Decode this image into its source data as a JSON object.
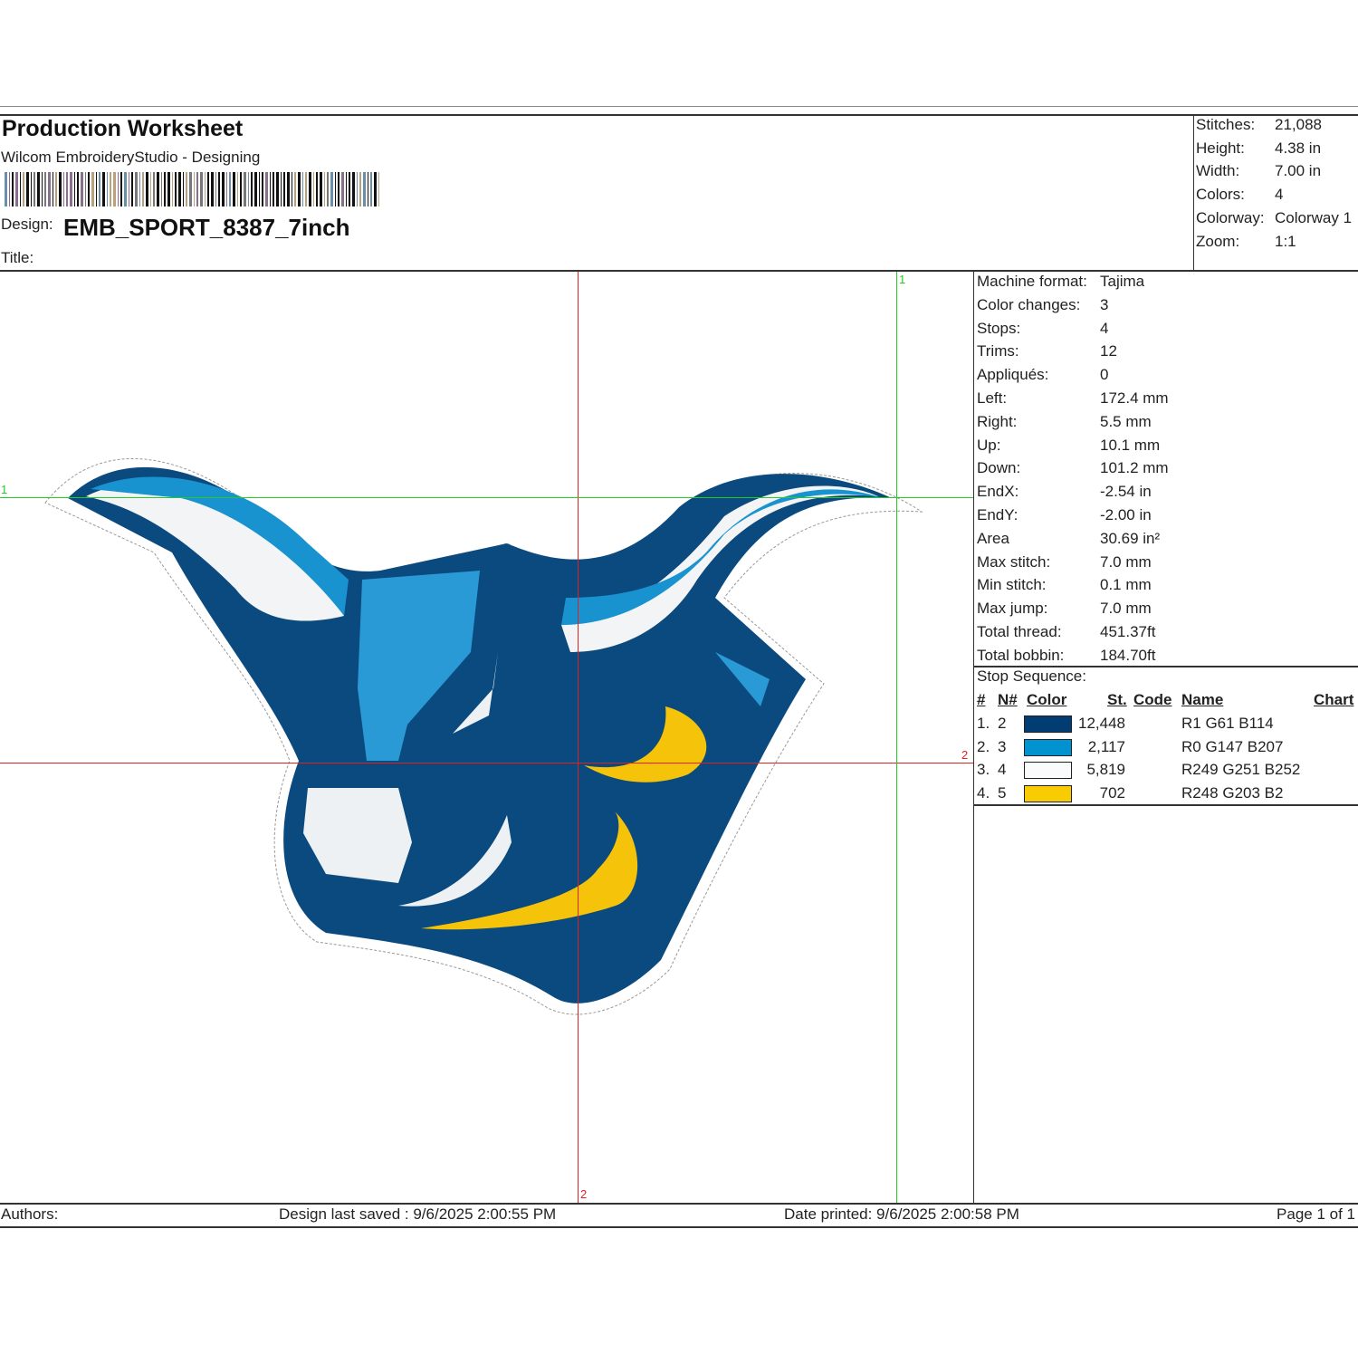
{
  "header": {
    "title": "Production Worksheet",
    "subtitle": "Wilcom EmbroideryStudio - Designing",
    "design_label": "Design:",
    "design_name": "EMB_SPORT_8387_7inch",
    "title_label": "Title:",
    "title_value": ""
  },
  "summary": [
    {
      "label": "Stitches:",
      "value": "21,088"
    },
    {
      "label": "Height:",
      "value": "4.38 in"
    },
    {
      "label": "Width:",
      "value": "7.00 in"
    },
    {
      "label": "Colors:",
      "value": "4"
    },
    {
      "label": "Colorway:",
      "value": "Colorway 1"
    },
    {
      "label": "Zoom:",
      "value": "1:1"
    }
  ],
  "details": [
    {
      "label": "Machine format:",
      "value": "Tajima"
    },
    {
      "label": "Color changes:",
      "value": "3"
    },
    {
      "label": "Stops:",
      "value": "4"
    },
    {
      "label": "Trims:",
      "value": "12"
    },
    {
      "label": "Appliqués:",
      "value": "0"
    },
    {
      "label": "Left:",
      "value": "172.4 mm"
    },
    {
      "label": "Right:",
      "value": "5.5 mm"
    },
    {
      "label": "Up:",
      "value": "10.1 mm"
    },
    {
      "label": "Down:",
      "value": "101.2 mm"
    },
    {
      "label": "EndX:",
      "value": "-2.54 in"
    },
    {
      "label": "EndY:",
      "value": "-2.00 in"
    },
    {
      "label": "Area",
      "value": " 30.69 in²"
    },
    {
      "label": "Max stitch:",
      "value": "7.0 mm"
    },
    {
      "label": "Min stitch:",
      "value": "0.1 mm"
    },
    {
      "label": "Max jump:",
      "value": "7.0 mm"
    },
    {
      "label": "Total thread:",
      "value": "451.37ft"
    },
    {
      "label": "Total bobbin:",
      "value": "184.70ft"
    }
  ],
  "stop_sequence": {
    "title": "Stop Sequence:",
    "columns": {
      "num": "#",
      "needle": "N#",
      "color": "Color",
      "stitches": "St.",
      "code": "Code",
      "name": "Name",
      "chart": "Chart"
    },
    "rows": [
      {
        "num": "1.",
        "needle": "2",
        "color": "#013d72",
        "stitches": "12,448",
        "name": "R1 G61 B114"
      },
      {
        "num": "2.",
        "needle": "3",
        "color": "#0093cf",
        "stitches": "2,117",
        "name": "R0 G147 B207"
      },
      {
        "num": "3.",
        "needle": "4",
        "color": "#f9fbfc",
        "stitches": "5,819",
        "name": "R249 G251 B252"
      },
      {
        "num": "4.",
        "needle": "5",
        "color": "#f8cb02",
        "stitches": "702",
        "name": "R248 G203 B2"
      }
    ]
  },
  "markers": {
    "green_v": "1",
    "green_h": "1",
    "red_v": "2",
    "red_h": "2"
  },
  "footer": {
    "authors": "Authors:",
    "saved": "Design last saved : 9/6/2025 2:00:55 PM",
    "printed": "Date printed: 9/6/2025 2:00:58 PM",
    "page": "Page 1 of 1"
  }
}
